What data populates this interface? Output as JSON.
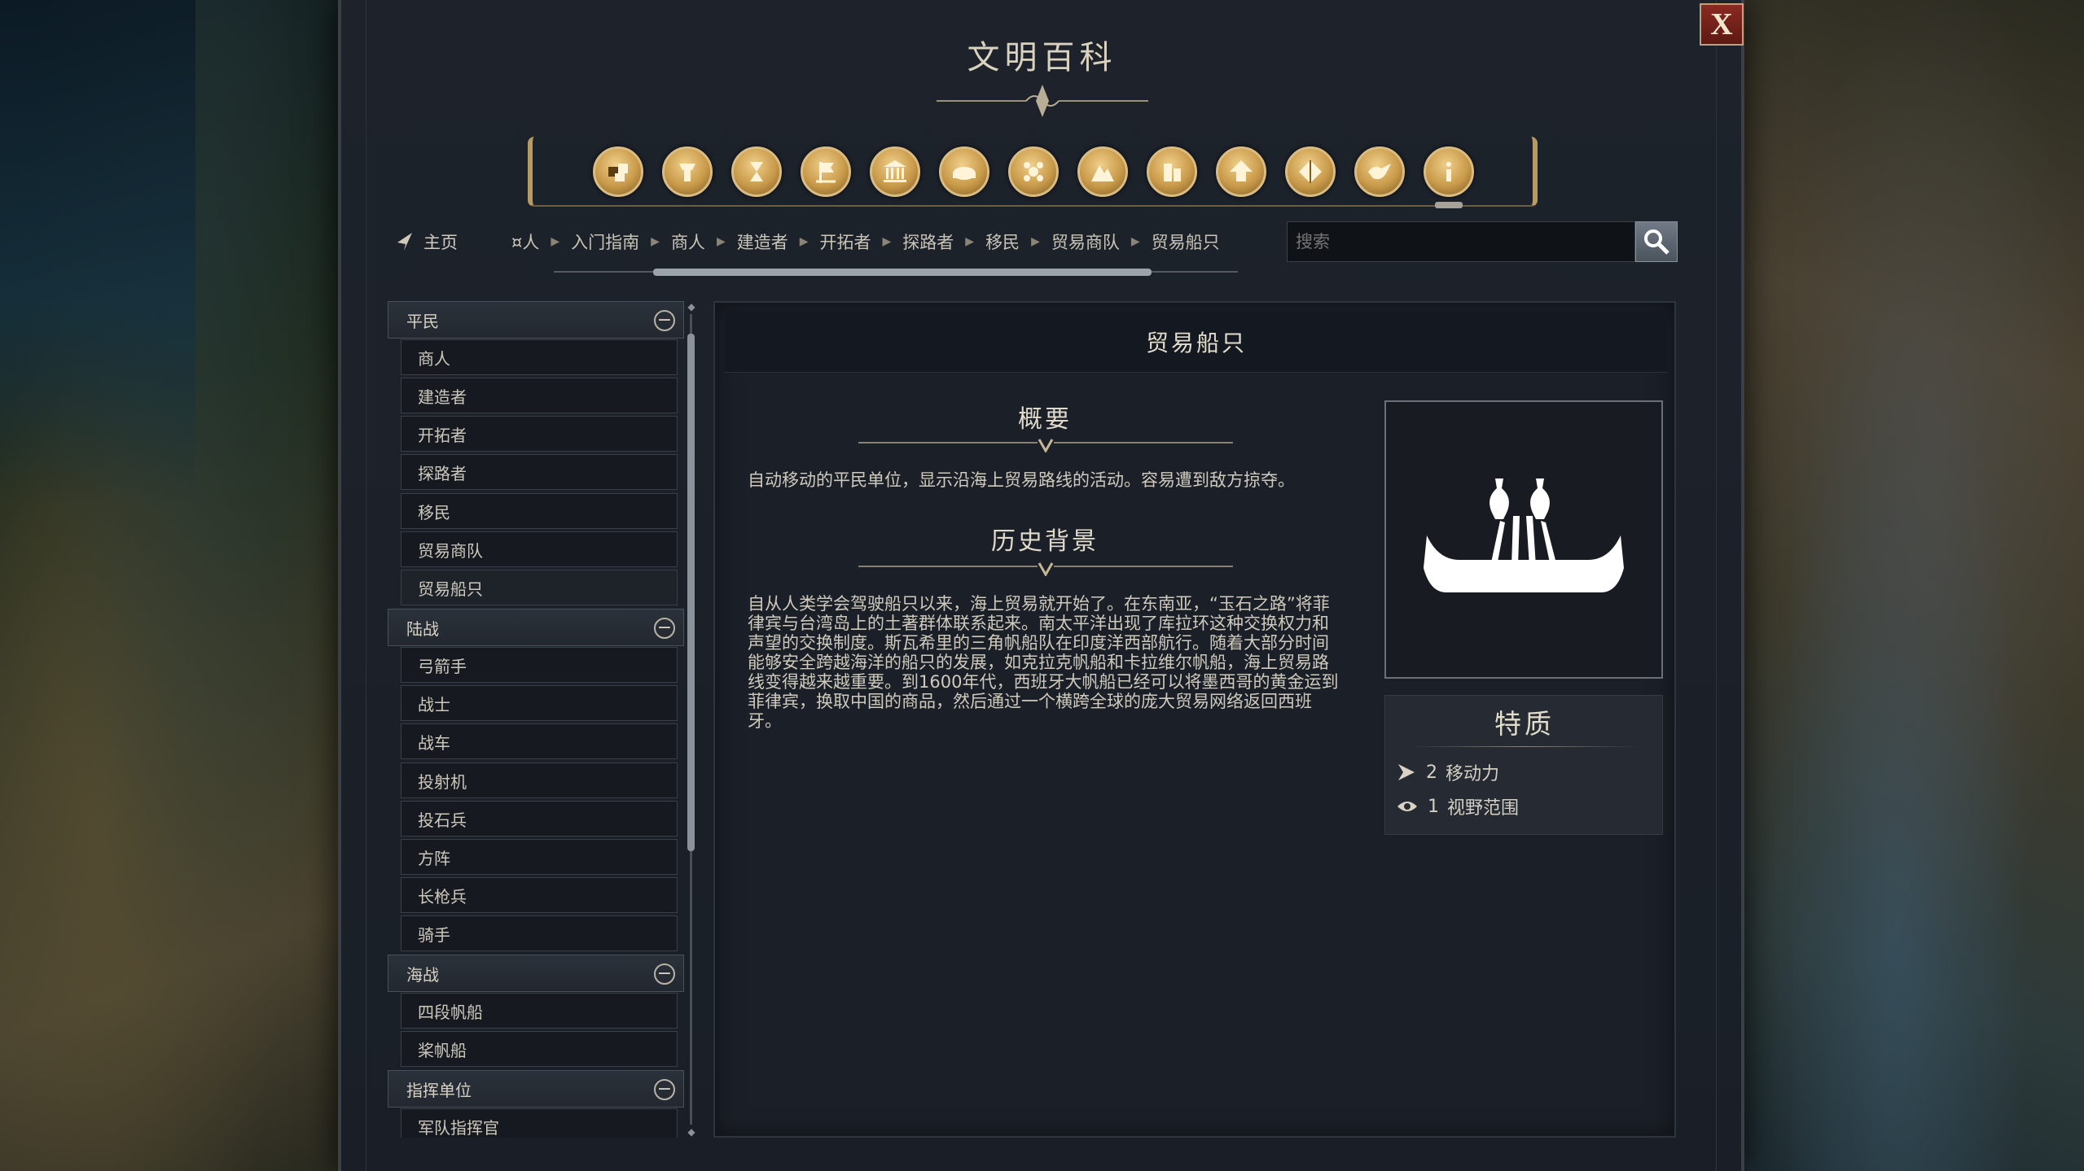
{
  "window": {
    "title": "文明百科",
    "close_label": "X"
  },
  "icon_bar": {
    "icons": [
      "units-icon",
      "buildings-icon",
      "eras-icon",
      "civilizations-icon",
      "government-icon",
      "resources-icon",
      "religion-icon",
      "terrain-icon",
      "districts-icon",
      "upgrades-icon",
      "technology-icon",
      "diplomacy-icon",
      "info-icon"
    ],
    "accent": "#c99a4a"
  },
  "nav": {
    "home_label": "主页",
    "breadcrumb": [
      "商人",
      "入门指南",
      "商人",
      "建造者",
      "开拓者",
      "探路者",
      "移民",
      "贸易商队",
      "贸易船只"
    ],
    "breadcrumb_first_visible": "¤人"
  },
  "search": {
    "placeholder": "搜索",
    "value": ""
  },
  "sidebar": {
    "categories": [
      {
        "label": "平民",
        "items": [
          "商人",
          "建造者",
          "开拓者",
          "探路者",
          "移民",
          "贸易商队",
          "贸易船只"
        ]
      },
      {
        "label": "陆战",
        "items": [
          "弓箭手",
          "战士",
          "战车",
          "投射机",
          "投石兵",
          "方阵",
          "长枪兵",
          "骑手"
        ]
      },
      {
        "label": "海战",
        "items": [
          "四段帆船",
          "桨帆船"
        ]
      },
      {
        "label": "指挥单位",
        "items": [
          "军队指挥官"
        ]
      }
    ],
    "toggle_symbol": "−"
  },
  "detail": {
    "title": "贸易船只",
    "overview_title": "概要",
    "overview_text": "自动移动的平民单位，显示沿海上贸易路线的活动。容易遭到敌方掠夺。",
    "history_title": "历史背景",
    "history_text": "自从人类学会驾驶船只以来，海上贸易就开始了。在东南亚，“玉石之路”将菲律宾与台湾岛上的土著群体联系起来。南太平洋出现了库拉环这种交换权力和声望的交换制度。斯瓦希里的三角帆船队在印度洋西部航行。随着大部分时间能够安全跨越海洋的船只的发展，如克拉克帆船和卡拉维尔帆船，海上贸易路线变得越来越重要。到1600年代，西班牙大帆船已经可以将墨西哥的黄金运到菲律宾，换取中国的商品，然后通过一个横跨全球的庞大贸易网络返回西班牙。",
    "portrait_icon": "trade-ship-icon",
    "traits": {
      "title": "特质",
      "rows": [
        {
          "icon": "movement-arrow-icon",
          "value": "2",
          "label": "移动力"
        },
        {
          "icon": "eye-icon",
          "value": "1",
          "label": "视野范围"
        }
      ]
    }
  }
}
